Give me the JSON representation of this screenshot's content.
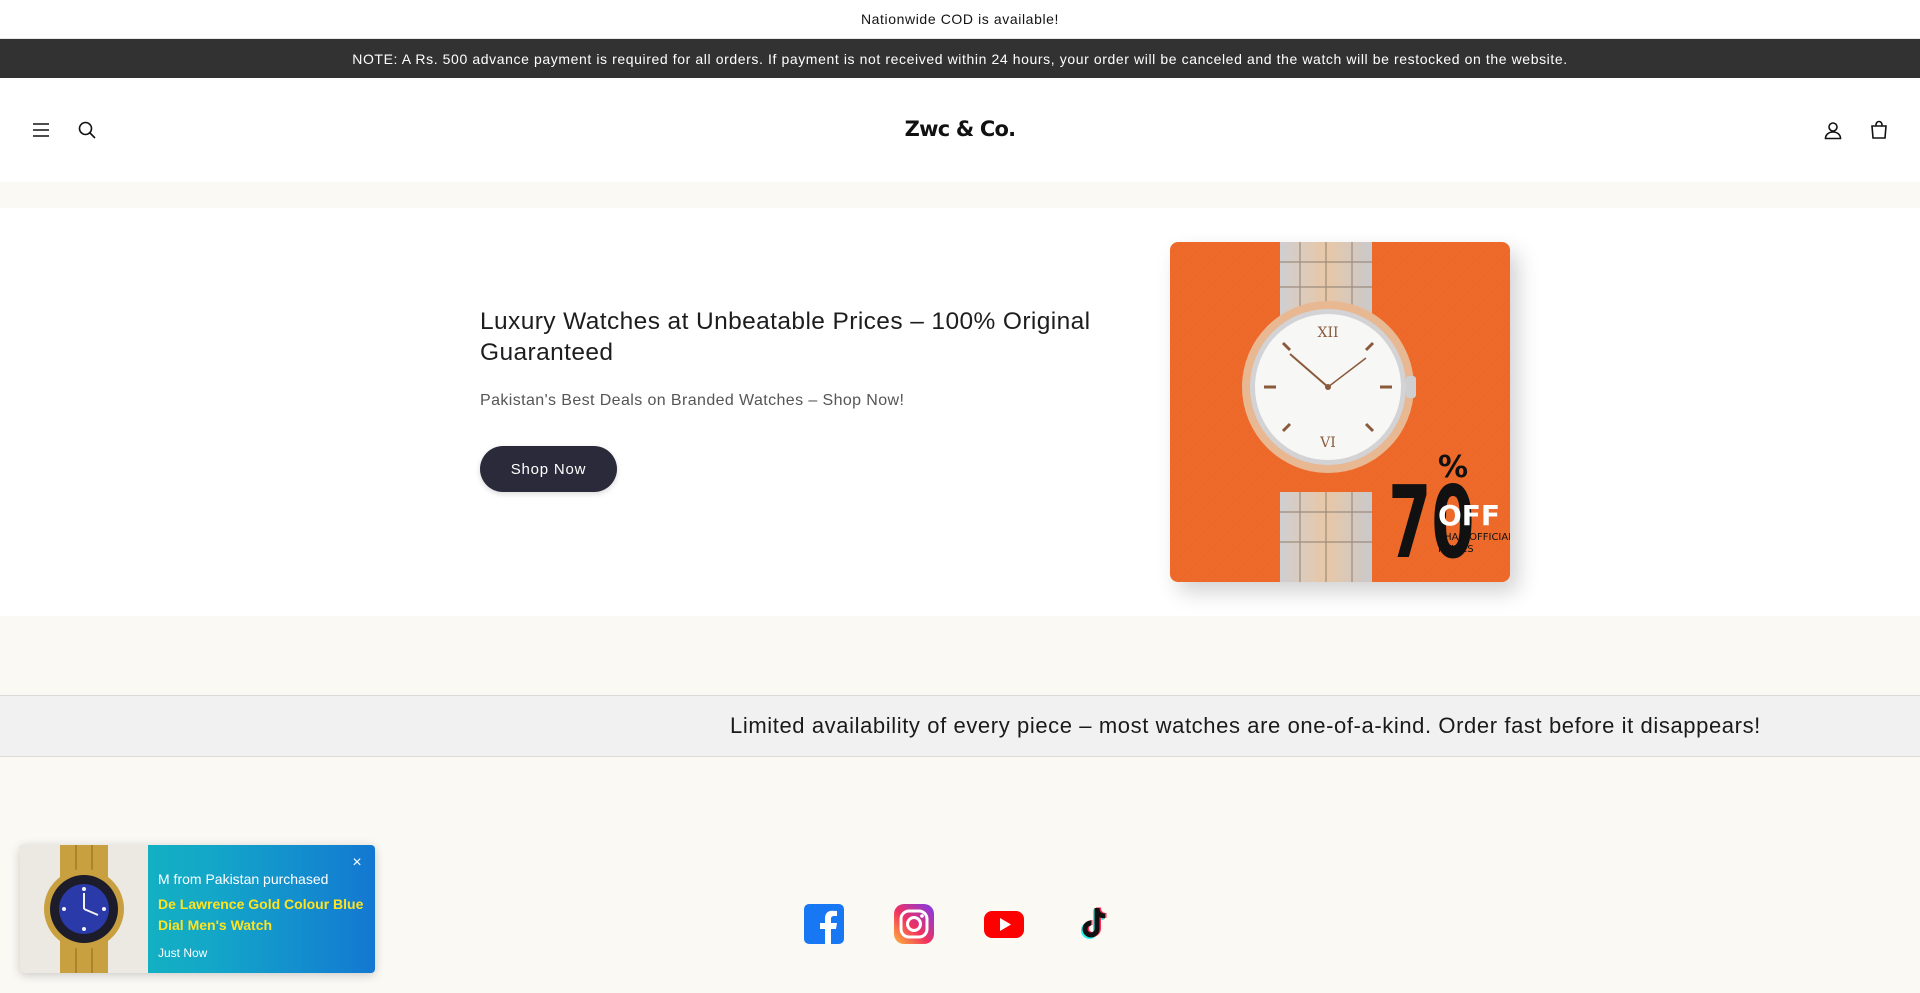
{
  "announcements": {
    "top": "Nationwide COD is available!",
    "note": "NOTE: A Rs. 500 advance payment is required for all orders. If payment is not received within 24 hours, your order will be canceled and the watch will be restocked on the website."
  },
  "header": {
    "logo": "Zwc & Co.",
    "icons": [
      "menu-icon",
      "search-icon",
      "account-icon",
      "cart-icon"
    ]
  },
  "hero": {
    "title": "Luxury Watches at Unbeatable Prices – 100% Original Guaranteed",
    "subtitle": "Pakistan's Best Deals on Branded Watches – Shop Now!",
    "button": "Shop Now",
    "image": {
      "big_text": "70",
      "percent": "%",
      "off": "OFF",
      "line1": "THAN OFFICIAL",
      "line2": "PRICES",
      "background": "#ee6a2a"
    }
  },
  "marquee": {
    "text": " Limited availability of every piece – most watches are one-of-a-kind. Order fast before it disappears!"
  },
  "socials": [
    "facebook-icon",
    "instagram-icon",
    "youtube-icon",
    "tiktok-icon"
  ],
  "popup": {
    "line1": "M from Pakistan purchased",
    "product": "De Lawrence Gold Colour Blue Dial Men's Watch",
    "time": "Just Now",
    "close": "×"
  },
  "colors": {
    "dark_bar": "#323232",
    "button": "#2b2a3a",
    "cream": "#fbf9f4",
    "popup_product": "#ffe31f"
  }
}
